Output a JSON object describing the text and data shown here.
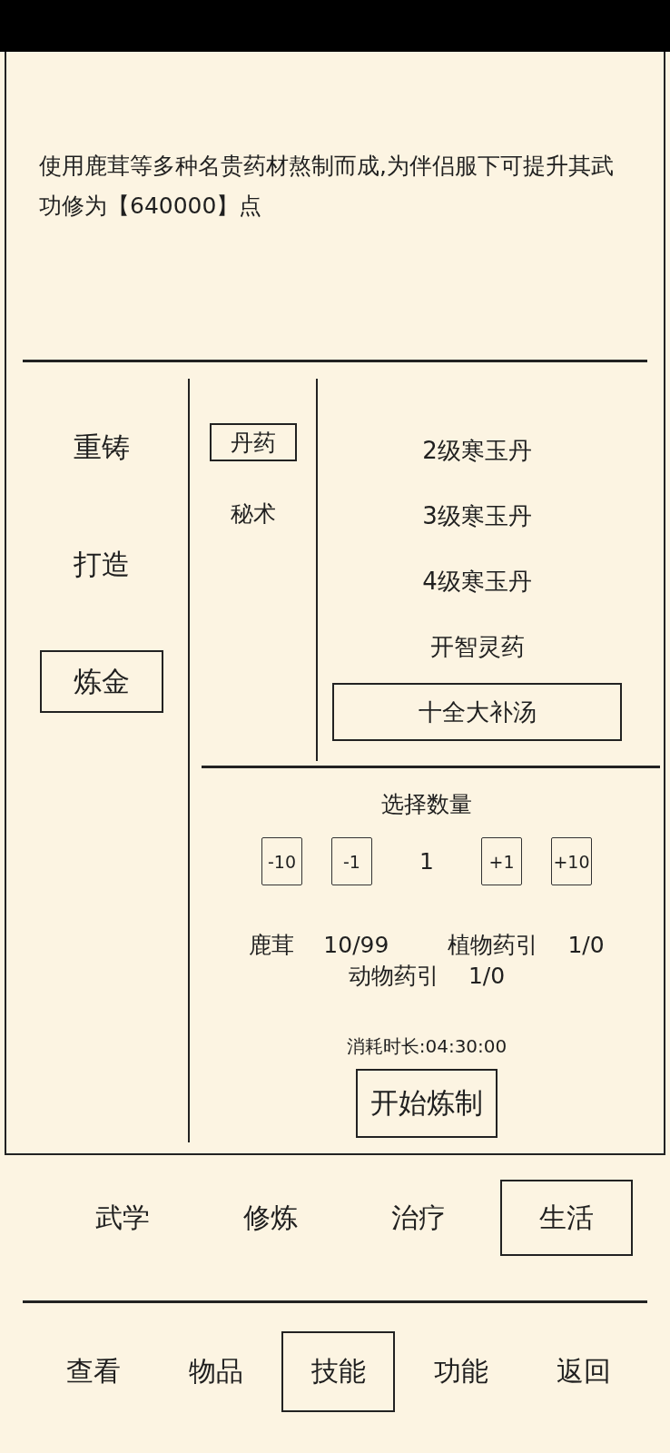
{
  "description": "使用鹿茸等多种名贵药材熬制而成,为伴侣服下可提升其武功修为【640000】点",
  "crafts": [
    {
      "label": "重铸",
      "selected": false
    },
    {
      "label": "打造",
      "selected": false
    },
    {
      "label": "炼金",
      "selected": true
    }
  ],
  "categories": [
    {
      "label": "丹药",
      "selected": true
    },
    {
      "label": "秘术",
      "selected": false
    }
  ],
  "recipes": [
    {
      "label": "2级寒玉丹",
      "selected": false
    },
    {
      "label": "3级寒玉丹",
      "selected": false
    },
    {
      "label": "4级寒玉丹",
      "selected": false
    },
    {
      "label": "开智灵药",
      "selected": false
    },
    {
      "label": "十全大补汤",
      "selected": true
    }
  ],
  "quantity": {
    "title": "选择数量",
    "decrease": [
      "-10",
      "-1"
    ],
    "value": "1",
    "increase": [
      "+1",
      "+10"
    ]
  },
  "materials": [
    {
      "name": "鹿茸",
      "count": "10/99"
    },
    {
      "name": "植物药引",
      "count": "1/0"
    },
    {
      "name": "动物药引",
      "count": "1/0"
    }
  ],
  "duration": "消耗时长:04:30:00",
  "start_button": "开始炼制",
  "skill_tabs": [
    {
      "label": "武学",
      "selected": false
    },
    {
      "label": "修炼",
      "selected": false
    },
    {
      "label": "治疗",
      "selected": false
    },
    {
      "label": "生活",
      "selected": true
    }
  ],
  "nav": [
    {
      "label": "查看",
      "selected": false
    },
    {
      "label": "物品",
      "selected": false
    },
    {
      "label": "技能",
      "selected": true
    },
    {
      "label": "功能",
      "selected": false
    },
    {
      "label": "返回",
      "selected": false
    }
  ]
}
